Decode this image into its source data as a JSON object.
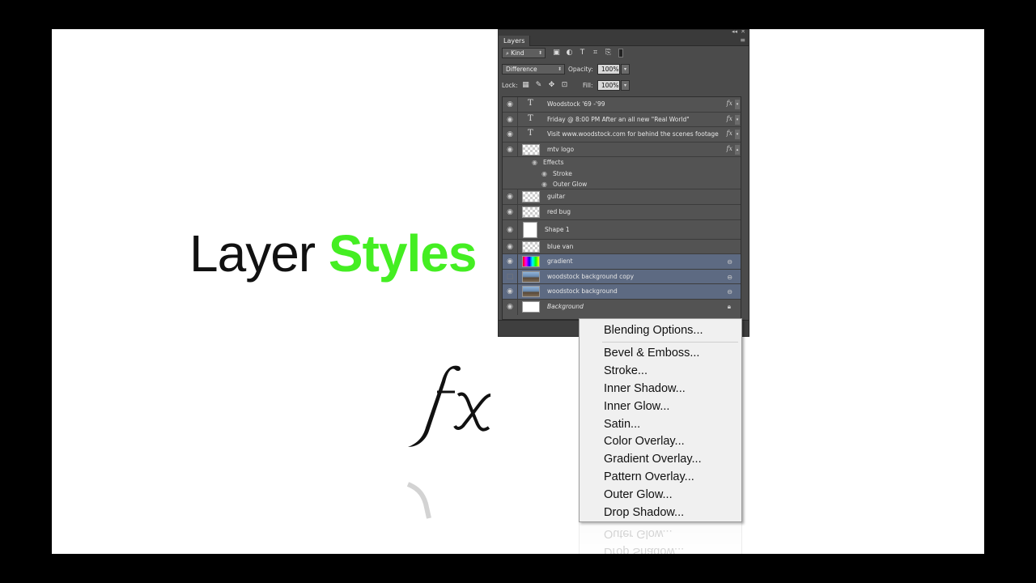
{
  "slide": {
    "title_word1": "Layer ",
    "title_word2": "Styles",
    "title_word2_color": "#44ee22"
  },
  "panel": {
    "topbar_left": "◂◂",
    "topbar_right": "✕",
    "tab_label": "Layers",
    "menu_icon": "≡",
    "filter_kind": "Kind",
    "blend_mode": "Difference",
    "opacity_label": "Opacity:",
    "opacity_value": "100%",
    "lock_label": "Lock:",
    "fill_label": "Fill:",
    "fill_value": "100%"
  },
  "layers": [
    {
      "name": "Woodstock '69 -'99",
      "kind": "text",
      "fx": "fx"
    },
    {
      "name": "Friday @ 8:00 PM  After an all new \"Real World\"",
      "kind": "text",
      "fx": "fx"
    },
    {
      "name": "Visit www.woodstock.com for behind the scenes footage",
      "kind": "text",
      "fx": "fx"
    },
    {
      "name": "mtv logo",
      "kind": "checker",
      "fx": "fx"
    },
    {
      "name": "guitar",
      "kind": "checker"
    },
    {
      "name": "red bug",
      "kind": "checker"
    },
    {
      "name": "Shape 1",
      "kind": "shape"
    },
    {
      "name": "blue van",
      "kind": "checker"
    },
    {
      "name": "gradient",
      "kind": "gradient",
      "selected": true
    },
    {
      "name": "woodstock background copy",
      "kind": "photo",
      "selected": true
    },
    {
      "name": "woodstock background",
      "kind": "photo",
      "selected": true
    },
    {
      "name": "Background",
      "kind": "white"
    }
  ],
  "effects": {
    "header": "Effects",
    "items": [
      "Stroke",
      "Outer Glow"
    ]
  },
  "menu": {
    "first": "Blending Options...",
    "items": [
      "Bevel & Emboss...",
      "Stroke...",
      "Inner Shadow...",
      "Inner Glow...",
      "Satin...",
      "Color Overlay...",
      "Gradient Overlay...",
      "Pattern Overlay...",
      "Outer Glow...",
      "Drop Shadow..."
    ]
  }
}
